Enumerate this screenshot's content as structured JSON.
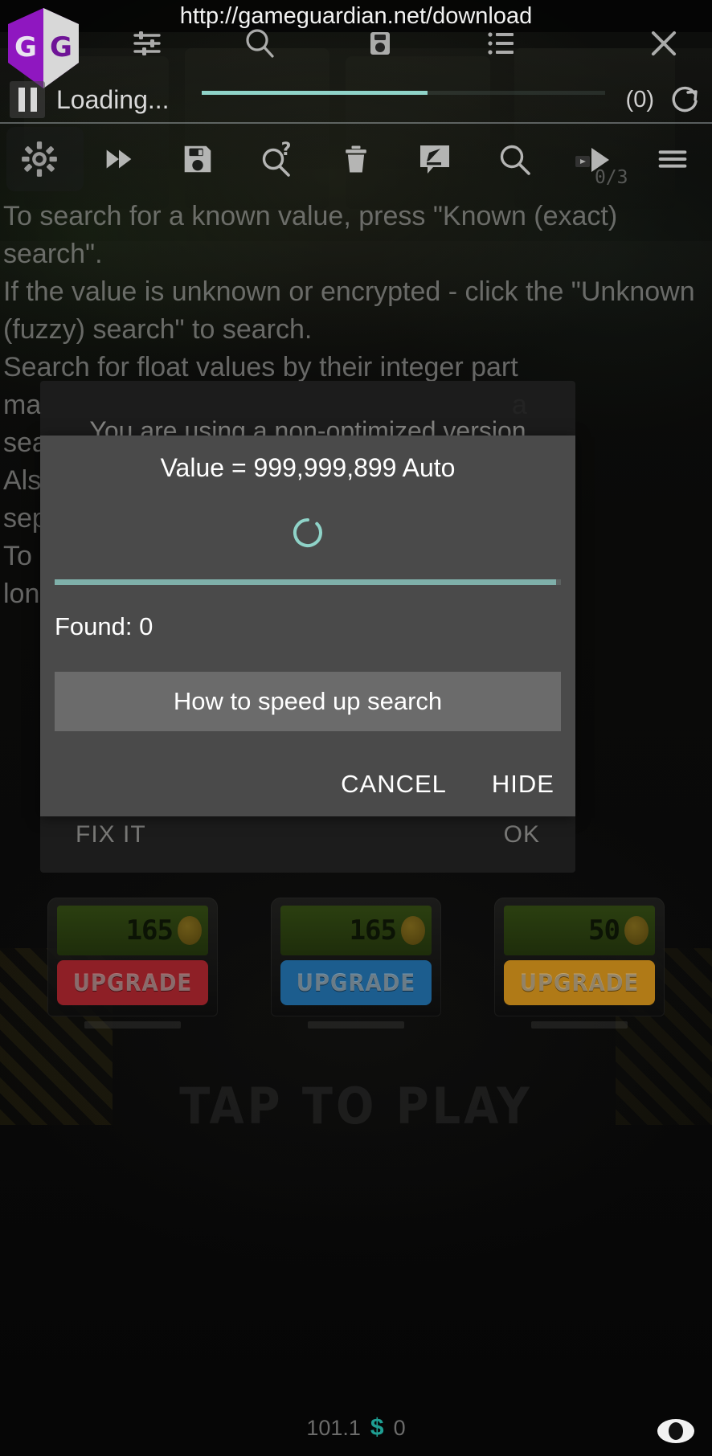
{
  "urlbar": {
    "url": "http://gameguardian.net/download"
  },
  "gg_header": {
    "logo_letters": "GG",
    "icons": [
      {
        "name": "sliders-icon",
        "label": "sliders"
      },
      {
        "name": "search-icon",
        "label": "search"
      },
      {
        "name": "lock-icon",
        "label": "lock"
      },
      {
        "name": "list-icon",
        "label": "list"
      },
      {
        "name": "close-icon",
        "label": "close"
      }
    ]
  },
  "loading": {
    "pause_label": "pause",
    "text": "Loading...",
    "progress_percent": 56,
    "count": "(0)",
    "refresh_label": "refresh"
  },
  "toolbar": {
    "items": [
      {
        "name": "settings-gear-icon",
        "label": "Settings"
      },
      {
        "name": "fast-forward-icon",
        "label": "Speed"
      },
      {
        "name": "save-icon",
        "label": "Save"
      },
      {
        "name": "search-unknown-icon",
        "label": "Unknown search"
      },
      {
        "name": "trash-icon",
        "label": "Clear"
      },
      {
        "name": "edit-icon",
        "label": "Edit"
      },
      {
        "name": "search-icon",
        "label": "Search"
      },
      {
        "name": "video-play-icon",
        "label": "Video",
        "badge": "0/3"
      },
      {
        "name": "menu-icon",
        "label": "Menu"
      }
    ]
  },
  "instructions": {
    "text": "To search for a known value, press \"Known (exact) search\".\nIf the value is unknown or encrypted - click the \"Unknown (fuzzy) search\" to search.\nSearch for float values by their integer part\nma                                                              a\nsea                                                           a\nAls                                                            a\nsep                                                           a\nTo                                                             a\nlon                                                        ion."
  },
  "background_dialog": {
    "message": "You are using a non-optimized version",
    "fix_label": "FIX IT",
    "ok_label": "OK"
  },
  "search_dialog": {
    "title": "Value = 999,999,899 Auto",
    "spinner_color": "#8fd3c8",
    "progress_percent": 99,
    "found_label": "Found: 0",
    "speed_button_label": "How to speed up search",
    "cancel_label": "CANCEL",
    "hide_label": "HIDE"
  },
  "game": {
    "machines": [
      {
        "cost": "165",
        "button_label": "UPGRADE",
        "color": "#8e1f26"
      },
      {
        "cost": "165",
        "button_label": "UPGRADE",
        "color": "#1c5d8e"
      },
      {
        "cost": "50",
        "button_label": "UPGRADE",
        "color": "#b07a17"
      }
    ],
    "tap_to_play": "TAP TO PLAY",
    "status": {
      "rate": "101.1",
      "currency_symbol": "$",
      "amount": "0"
    },
    "eye_label": "visibility"
  }
}
